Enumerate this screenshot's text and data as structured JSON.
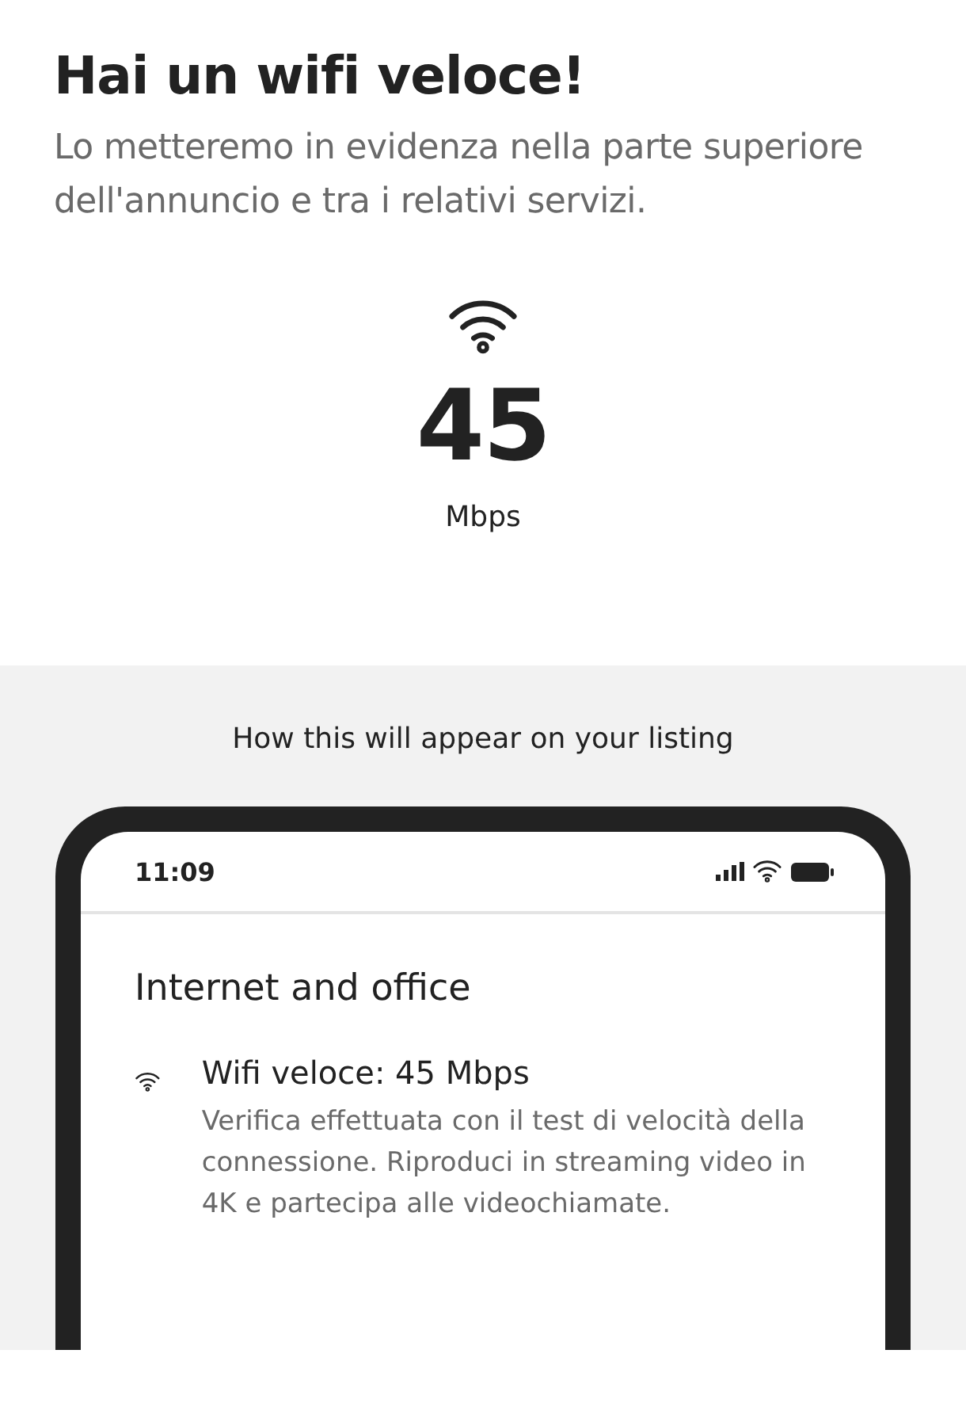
{
  "header": {
    "title": "Hai un wifi veloce!",
    "subtitle": "Lo metteremo in evidenza nella parte superiore dell'annuncio e tra i relativi servizi."
  },
  "speed": {
    "value": "45",
    "unit": "Mbps"
  },
  "preview": {
    "caption": "How this will appear on your listing",
    "phone": {
      "time": "11:09",
      "section_title": "Internet and office",
      "amenity_title": "Wifi veloce: 45 Mbps",
      "amenity_description": "Verifica effettuata con il test di velocità della connessione. Riproduci in streaming video in 4K e partecipa alle videochiamate."
    }
  }
}
